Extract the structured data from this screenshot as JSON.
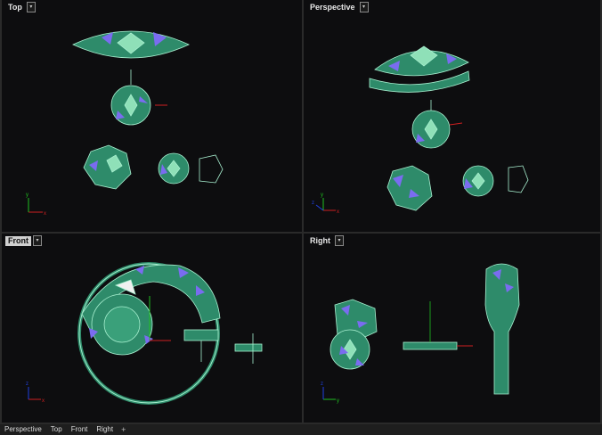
{
  "viewports": {
    "top": {
      "title": "Top"
    },
    "perspective": {
      "title": "Perspective"
    },
    "front": {
      "title": "Front"
    },
    "right": {
      "title": "Right"
    }
  },
  "axis_labels": {
    "x": "x",
    "y": "y",
    "z": "z"
  },
  "tabs": [
    "Perspective",
    "Top",
    "Front",
    "Right"
  ],
  "tab_add_symbol": "+",
  "colors": {
    "background": "#0d0d0f",
    "model": "#2e8b6a",
    "model_edge": "#a8f0d0",
    "gem": "#7a6cf0",
    "axis_x": "#d02020",
    "axis_y": "#20c020",
    "axis_z": "#2040e0"
  }
}
